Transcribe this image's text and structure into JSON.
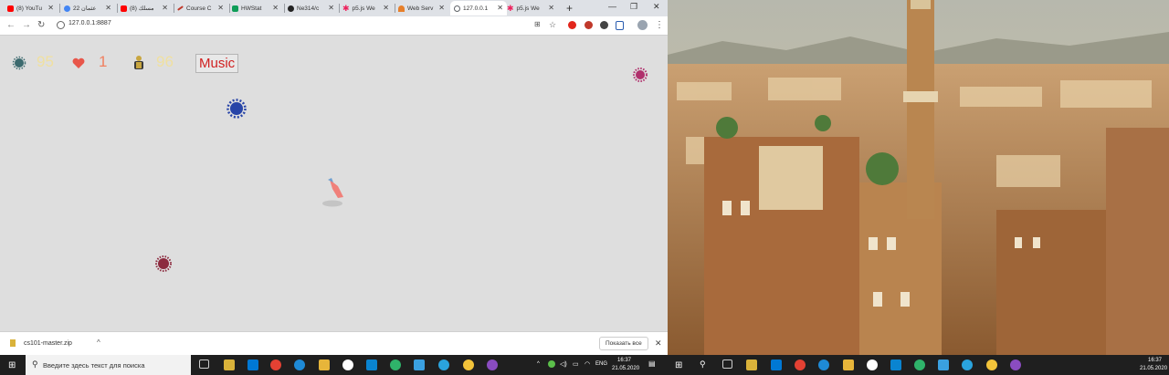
{
  "browser": {
    "tabs": [
      {
        "label": "(8) YouTu",
        "color": "#ff0000"
      },
      {
        "label": "عثمان 22",
        "color": "#4285f4"
      },
      {
        "label": "(8) مسلك",
        "color": "#ff0000"
      },
      {
        "label": "Course C",
        "color": "#c0392b"
      },
      {
        "label": "HWStat",
        "color": "#0f9d58"
      },
      {
        "label": "Ne314/c",
        "color": "#222222"
      },
      {
        "label": "p5.js We",
        "color": "#ed225d"
      },
      {
        "label": "Web Serv",
        "color": "#e77f2a"
      },
      {
        "label": "127.0.0.1",
        "color": "#5f6368"
      },
      {
        "label": "p5.js We",
        "color": "#ed225d"
      }
    ],
    "new_tab_label": "+",
    "url": "127.0.0.1:8887"
  },
  "game": {
    "virus_count": "95",
    "lives": "1",
    "people_count": "96",
    "music_button": "Music"
  },
  "download": {
    "file": "cs101-master.zip",
    "show_all": "Показать все"
  },
  "taskbar": {
    "search_placeholder": "Введите здесь текст для поиска",
    "lang": "ENG",
    "time": "16:37",
    "date": "21.05.2020",
    "time2": "16:37",
    "date2": "21.05.2020"
  }
}
